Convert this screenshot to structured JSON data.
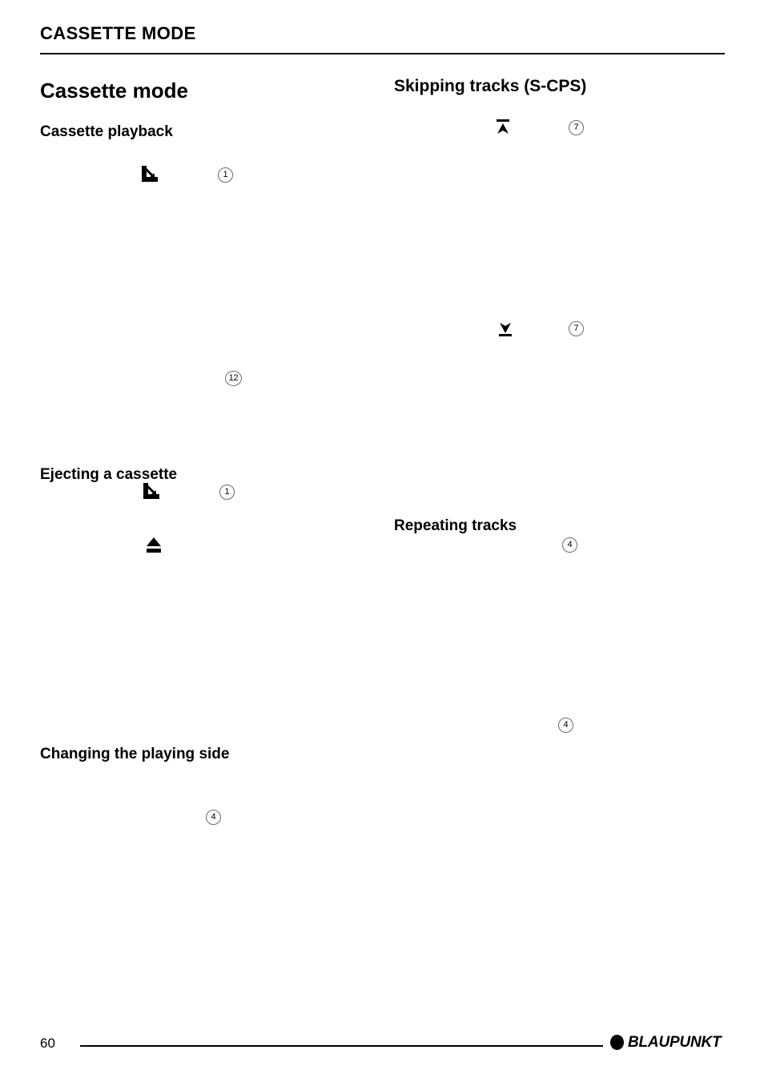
{
  "document": {
    "running_header": "CASSETTE MODE",
    "page_number": "60"
  },
  "left_column": {
    "title": "Cassette mode",
    "sections": [
      {
        "heading": "Cassette playback",
        "body": "",
        "steps": [
          {
            "icon": "flip-panel-icon",
            "badge": "1"
          },
          {
            "icon": "",
            "badge": "12"
          }
        ]
      },
      {
        "heading": "Ejecting a cassette",
        "body": "",
        "steps": [
          {
            "icon": "flip-panel-icon",
            "badge": "1"
          },
          {
            "icon": "eject-icon",
            "badge": ""
          }
        ]
      },
      {
        "heading": "Changing the playing side",
        "body": "",
        "steps": [
          {
            "icon": "",
            "badge": "4"
          }
        ]
      }
    ]
  },
  "right_column": {
    "sections": [
      {
        "heading": "Skipping tracks (S-CPS)",
        "body": "",
        "steps": [
          {
            "icon": "skip-up-icon",
            "badge": "7"
          },
          {
            "icon": "skip-down-icon",
            "badge": "7"
          }
        ]
      },
      {
        "heading": "Repeating tracks",
        "body": "",
        "steps": [
          {
            "icon": "",
            "badge": "4"
          },
          {
            "icon": "",
            "badge": "4"
          }
        ]
      }
    ]
  },
  "footer": {
    "page_number": "60",
    "brand": "BLAUPUNKT"
  },
  "colors": {
    "text": "#000000",
    "background": "#ffffff",
    "rule": "#000000",
    "badge_border": "#6a6a6a"
  }
}
